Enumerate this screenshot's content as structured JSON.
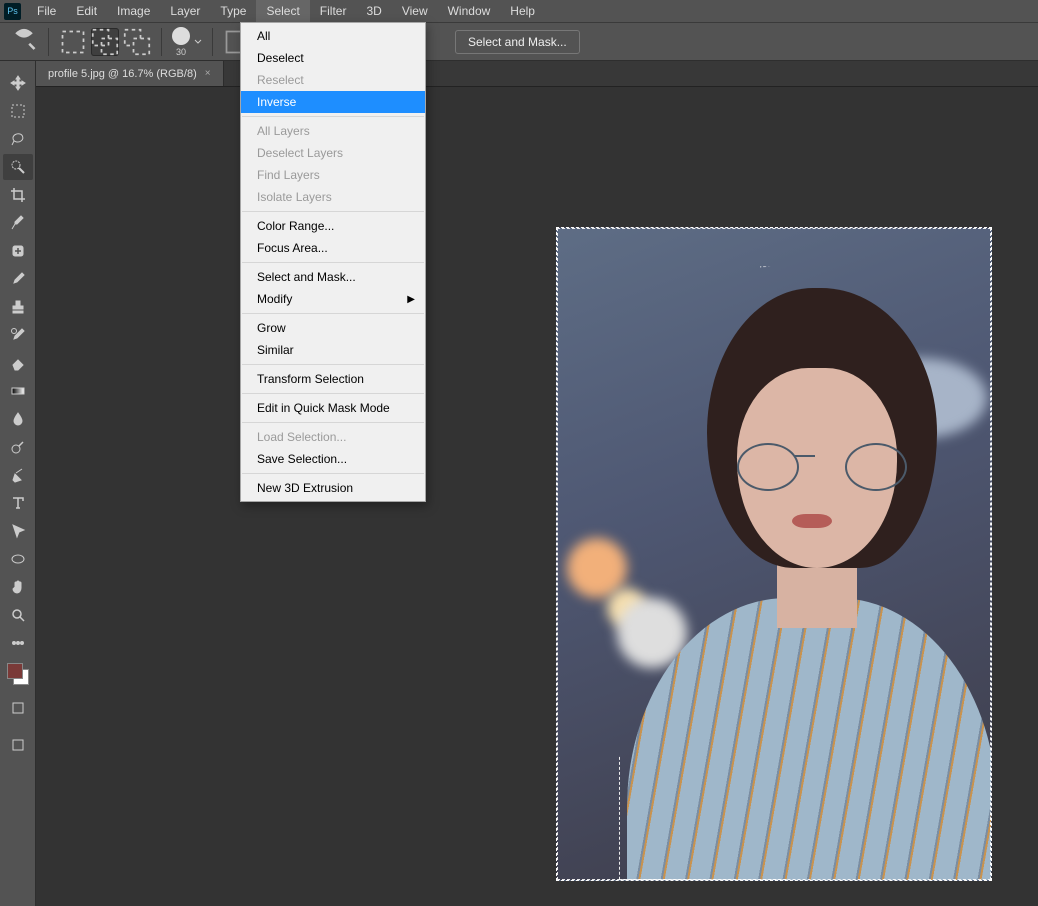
{
  "app": {
    "logo": "Ps"
  },
  "menubar": [
    "File",
    "Edit",
    "Image",
    "Layer",
    "Type",
    "Select",
    "Filter",
    "3D",
    "View",
    "Window",
    "Help"
  ],
  "menubar_open_index": 5,
  "optionbar": {
    "brush_size": "30",
    "select_and_mask": "Select and Mask..."
  },
  "tab": {
    "label": "profile 5.jpg @ 16.7% (RGB/8)",
    "close": "×"
  },
  "tools": [
    "move",
    "marquee",
    "lasso",
    "quick-select",
    "crop",
    "eyedropper",
    "healing",
    "brush",
    "stamp",
    "history-brush",
    "eraser",
    "gradient",
    "blur",
    "dodge",
    "pen",
    "type",
    "path-select",
    "shape",
    "hand",
    "zoom",
    "more"
  ],
  "dropdown": {
    "groups": [
      [
        {
          "label": "All",
          "disabled": false
        },
        {
          "label": "Deselect",
          "disabled": false
        },
        {
          "label": "Reselect",
          "disabled": true
        },
        {
          "label": "Inverse",
          "disabled": false,
          "highlight": true
        }
      ],
      [
        {
          "label": "All Layers",
          "disabled": true
        },
        {
          "label": "Deselect Layers",
          "disabled": true
        },
        {
          "label": "Find Layers",
          "disabled": true
        },
        {
          "label": "Isolate Layers",
          "disabled": true
        }
      ],
      [
        {
          "label": "Color Range...",
          "disabled": false
        },
        {
          "label": "Focus Area...",
          "disabled": false
        }
      ],
      [
        {
          "label": "Select and Mask...",
          "disabled": false
        },
        {
          "label": "Modify",
          "disabled": false,
          "submenu": true
        }
      ],
      [
        {
          "label": "Grow",
          "disabled": false
        },
        {
          "label": "Similar",
          "disabled": false
        }
      ],
      [
        {
          "label": "Transform Selection",
          "disabled": false
        }
      ],
      [
        {
          "label": "Edit in Quick Mask Mode",
          "disabled": false
        }
      ],
      [
        {
          "label": "Load Selection...",
          "disabled": true
        },
        {
          "label": "Save Selection...",
          "disabled": false
        }
      ],
      [
        {
          "label": "New 3D Extrusion",
          "disabled": false
        }
      ]
    ]
  }
}
